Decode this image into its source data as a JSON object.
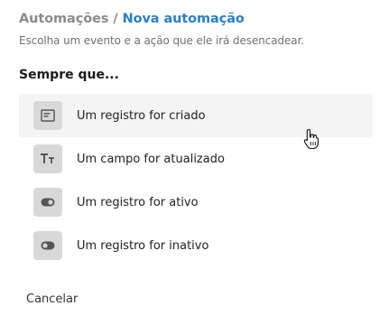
{
  "breadcrumb": {
    "parent": "Automações",
    "separator": "/",
    "current": "Nova automação"
  },
  "subtitle": "Escolha um evento e a ação que ele irá desencadear.",
  "section_title": "Sempre que...",
  "options": [
    {
      "label": "Um registro for criado",
      "icon": "form-icon",
      "hovered": true
    },
    {
      "label": "Um campo for atualizado",
      "icon": "text-type-icon",
      "hovered": false
    },
    {
      "label": "Um registro for ativo",
      "icon": "toggle-on-icon",
      "hovered": false
    },
    {
      "label": "Um registro for inativo",
      "icon": "toggle-off-icon",
      "hovered": false
    }
  ],
  "cancel_label": "Cancelar",
  "colors": {
    "accent": "#2a7fc4",
    "muted": "#8b8b8b",
    "icon_bg": "#d8d8d8",
    "hover_bg": "#f4f4f4"
  }
}
